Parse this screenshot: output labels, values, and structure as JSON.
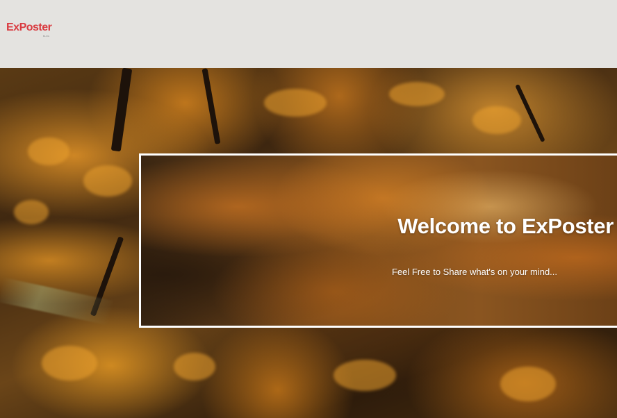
{
  "header": {
    "logo_text": "ExPoster",
    "logo_subtext": "BLOG",
    "background_color": "#e4e3e0",
    "logo_color": "#d93a3f"
  },
  "hero": {
    "background_image": "autumn-forest-photo",
    "welcome_title": "Welcome to ExPoster",
    "welcome_subtitle": "Feel Free to Share what's on your mind..."
  }
}
